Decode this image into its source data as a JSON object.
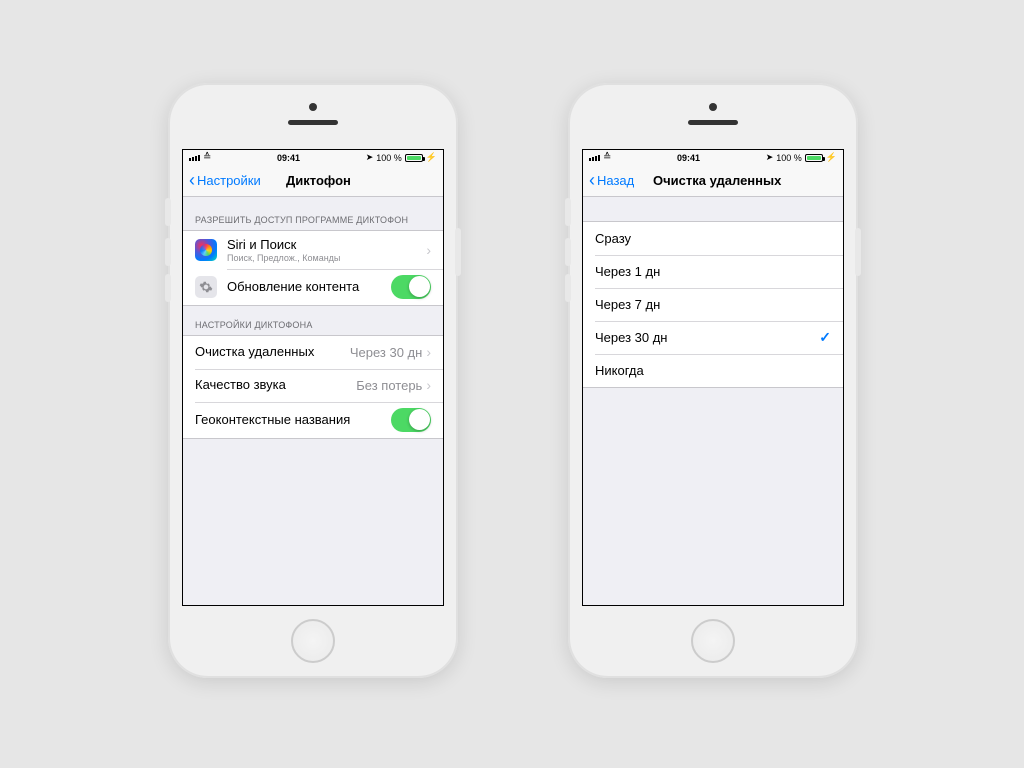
{
  "status": {
    "time": "09:41",
    "battery": "100 %"
  },
  "left": {
    "back": "Настройки",
    "title": "Диктофон",
    "section1": "РАЗРЕШИТЬ ДОСТУП ПРОГРАММЕ ДИКТОФОН",
    "row_siri": {
      "title": "Siri и Поиск",
      "sub": "Поиск, Предлож., Команды"
    },
    "row_refresh": "Обновление контента",
    "section2": "НАСТРОЙКИ ДИКТОФОНА",
    "row_clear": {
      "title": "Очистка удаленных",
      "value": "Через 30 дн"
    },
    "row_quality": {
      "title": "Качество звука",
      "value": "Без потерь"
    },
    "row_geo": "Геоконтекстные названия"
  },
  "right": {
    "back": "Назад",
    "title": "Очистка удаленных",
    "options": [
      {
        "label": "Сразу",
        "selected": false
      },
      {
        "label": "Через 1 дн",
        "selected": false
      },
      {
        "label": "Через 7 дн",
        "selected": false
      },
      {
        "label": "Через 30 дн",
        "selected": true
      },
      {
        "label": "Никогда",
        "selected": false
      }
    ]
  }
}
